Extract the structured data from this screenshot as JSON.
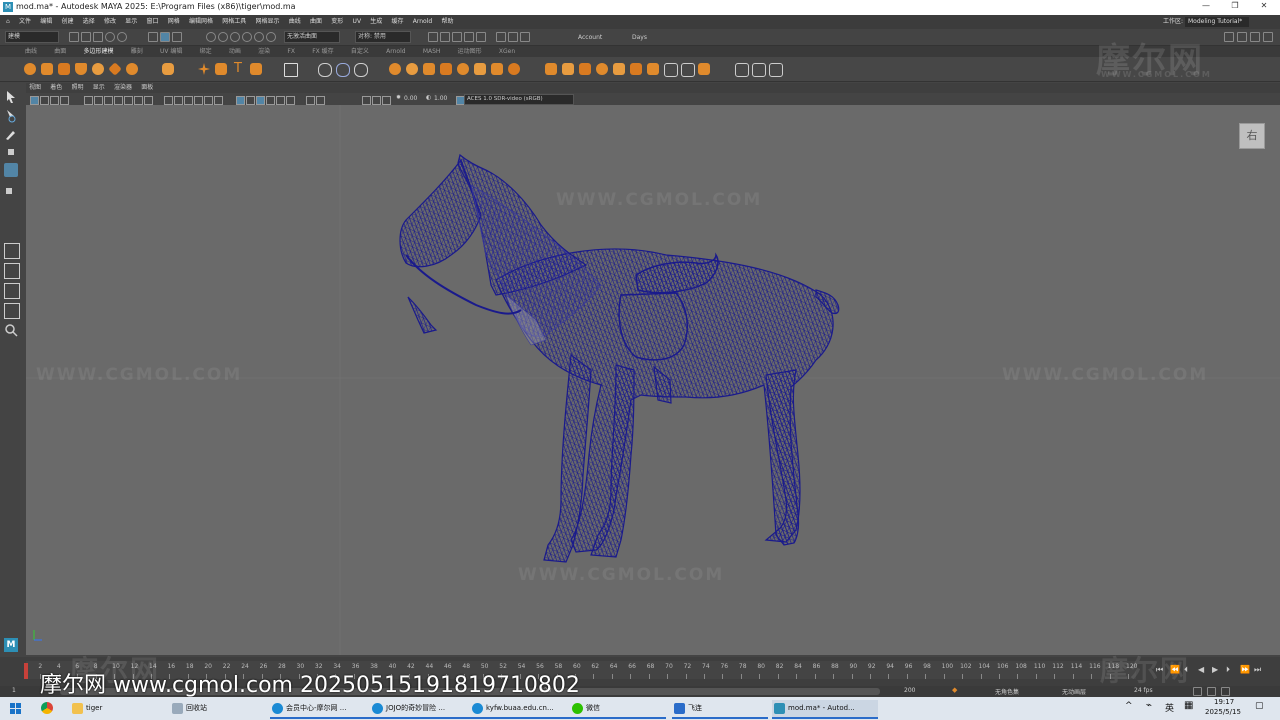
{
  "window": {
    "title": "mod.ma* - Autodesk MAYA 2025: E:\\Program Files (x86)\\tiger\\mod.ma",
    "logo": "M",
    "minimize": "—",
    "restore": "❐",
    "close": "✕"
  },
  "menu": {
    "items": [
      "文件",
      "编辑",
      "创建",
      "选择",
      "修改",
      "显示",
      "窗口",
      "网格",
      "编辑网格",
      "网格工具",
      "网格显示",
      "曲线",
      "曲面",
      "变形",
      "UV",
      "生成",
      "缓存",
      "Arnold",
      "帮助"
    ],
    "workspace_label": "工作区:",
    "workspace_value": "Modeling Tutorial*"
  },
  "statusline": {
    "mode": "建模",
    "live_surface": "无激活曲面",
    "symmetry": "对称: 禁用",
    "account": "Account",
    "days": "Days"
  },
  "shelf_tabs": [
    "曲线",
    "曲面",
    "多边形建模",
    "雕刻",
    "UV 编辑",
    "绑定",
    "动画",
    "渲染",
    "FX",
    "FX 缓存",
    "自定义",
    "Arnold",
    "MASH",
    "运动图形",
    "XGen"
  ],
  "panel": {
    "menu": [
      "视图",
      "着色",
      "照明",
      "显示",
      "渲染器",
      "面板"
    ],
    "exposure": "0.00",
    "gamma": "1.00",
    "colorspace": "ACES 1.0 SDR-video (sRGB)",
    "viewcube_label": "右"
  },
  "watermarks": {
    "top_right": "摩尔网",
    "top_right_sub": "WWW.CGMOL.COM",
    "center": "WWW.CGMOL.COM",
    "left": "WWW.CGMOL.COM",
    "right": "WWW.CGMOL.COM",
    "bottom_center": "WWW.CGMOL.COM",
    "bottom_left": "摩尔网",
    "bottom_right": "摩尔网",
    "bottom_text": "摩尔网 www.cgmol.com 20250515191819710802"
  },
  "timeline": {
    "ticks": [
      "2",
      "4",
      "6",
      "8",
      "10",
      "12",
      "14",
      "16",
      "18",
      "20",
      "22",
      "24",
      "26",
      "28",
      "30",
      "32",
      "34",
      "36",
      "38",
      "40",
      "42",
      "44",
      "46",
      "48",
      "50",
      "52",
      "54",
      "56",
      "58",
      "60",
      "62",
      "64",
      "66",
      "68",
      "70",
      "72",
      "74",
      "76",
      "78",
      "80",
      "82",
      "84",
      "86",
      "88",
      "90",
      "92",
      "94",
      "96",
      "98",
      "100",
      "102",
      "104",
      "106",
      "108",
      "110",
      "112",
      "114",
      "116",
      "118",
      "120"
    ],
    "current": "1",
    "range_start": "120",
    "range_end": "200",
    "character_set": "无角色集",
    "anim_layer": "无动画层",
    "fps": "24 fps"
  },
  "taskbar": {
    "items": [
      "tiger",
      "回收站",
      "会员中心-摩尔网 ...",
      "JOJO的奇妙冒险 ...",
      "kyfw.buaa.edu.cn...",
      "微信",
      "飞连",
      "mod.ma* - Autod..."
    ],
    "lang": "英",
    "time": "19:17",
    "date": "2025/5/15"
  },
  "colors": {
    "viewport": "#6a6a6a",
    "wireframe": "#1a1a8c",
    "accent": "#2d8fb5",
    "shelf_icon": "#e08a2c"
  },
  "icons": [
    "maya-logo-icon",
    "select-tool-icon",
    "lasso-tool-icon",
    "paint-select-icon",
    "move-tool-icon",
    "rotate-tool-icon",
    "scale-tool-icon",
    "search-icon",
    "windows-start-icon",
    "chrome-icon",
    "folder-icon",
    "recycle-bin-icon",
    "edge-icon",
    "wechat-icon",
    "feilian-icon",
    "maya-icon"
  ]
}
